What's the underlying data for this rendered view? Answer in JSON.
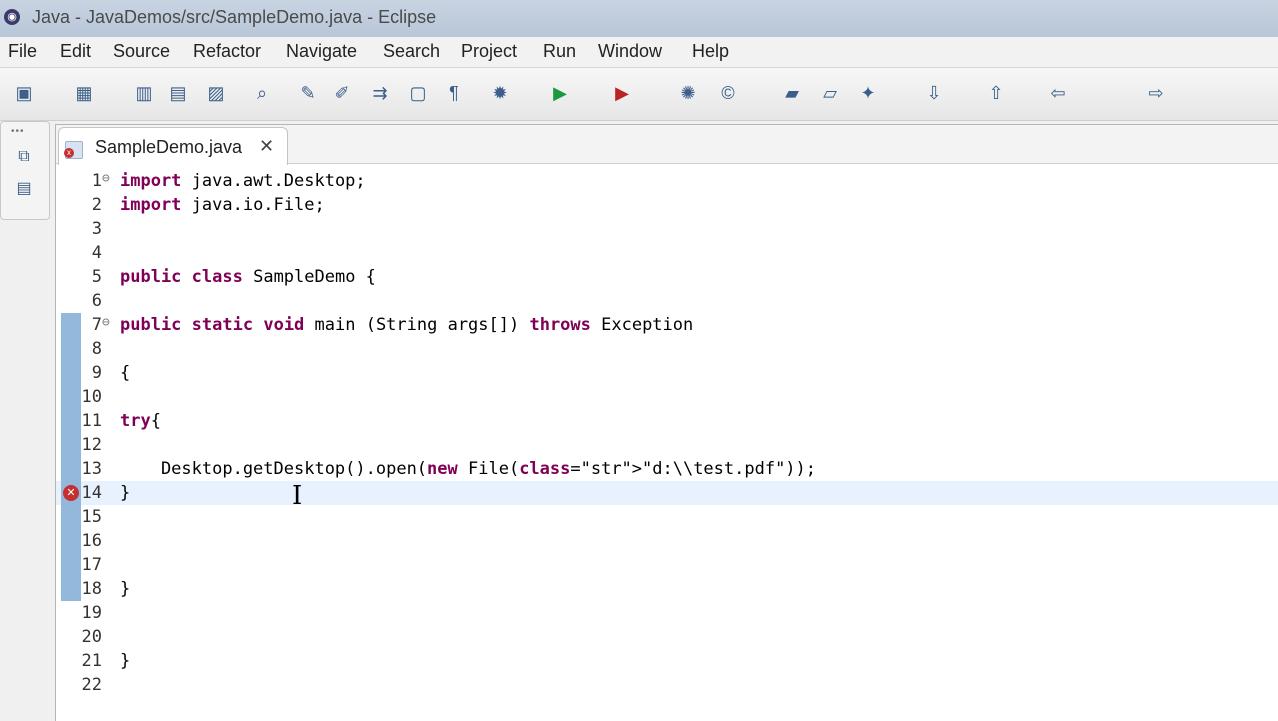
{
  "window": {
    "title": "Java - JavaDemos/src/SampleDemo.java - Eclipse"
  },
  "menu": [
    {
      "label": "File"
    },
    {
      "label": "Edit"
    },
    {
      "label": "Source"
    },
    {
      "label": "Refactor"
    },
    {
      "label": "Navigate"
    },
    {
      "label": "Search"
    },
    {
      "label": "Project"
    },
    {
      "label": "Run"
    },
    {
      "label": "Window"
    },
    {
      "label": "Help"
    }
  ],
  "toolbar_icons": [
    "new-icon",
    "new-type-icon",
    "save-icon",
    "save-all-icon",
    "print-icon",
    "search-icon",
    "open-type-icon",
    "annotation-icon",
    "next-icon",
    "toggle-icon",
    "show-whitespace-icon",
    "debug-icon",
    "run-icon",
    "run-external-icon",
    "new-package-icon",
    "new-class-icon",
    "open-folder-icon",
    "open-folder2-icon",
    "wand-icon",
    "next-annotation-icon",
    "prev-annotation-icon",
    "back-icon",
    "forward-icon"
  ],
  "editor": {
    "tab_label": "SampleDemo.java",
    "lines": [
      {
        "n": "1",
        "text": "import java.awt.Desktop;"
      },
      {
        "n": "2",
        "text": "import java.io.File;"
      },
      {
        "n": "3",
        "text": ""
      },
      {
        "n": "4",
        "text": ""
      },
      {
        "n": "5",
        "text": "public class SampleDemo {"
      },
      {
        "n": "6",
        "text": ""
      },
      {
        "n": "7",
        "text": "public static void main (String args[]) throws Exception"
      },
      {
        "n": "8",
        "text": ""
      },
      {
        "n": "9",
        "text": "{"
      },
      {
        "n": "10",
        "text": ""
      },
      {
        "n": "11",
        "text": "try{"
      },
      {
        "n": "12",
        "text": ""
      },
      {
        "n": "13",
        "text": "    Desktop.getDesktop().open(new File(\"d:\\\\test.pdf\"));"
      },
      {
        "n": "14",
        "text": "}"
      },
      {
        "n": "15",
        "text": ""
      },
      {
        "n": "16",
        "text": ""
      },
      {
        "n": "17",
        "text": ""
      },
      {
        "n": "18",
        "text": "}"
      },
      {
        "n": "19",
        "text": ""
      },
      {
        "n": "20",
        "text": ""
      },
      {
        "n": "21",
        "text": "}"
      },
      {
        "n": "22",
        "text": ""
      }
    ]
  }
}
